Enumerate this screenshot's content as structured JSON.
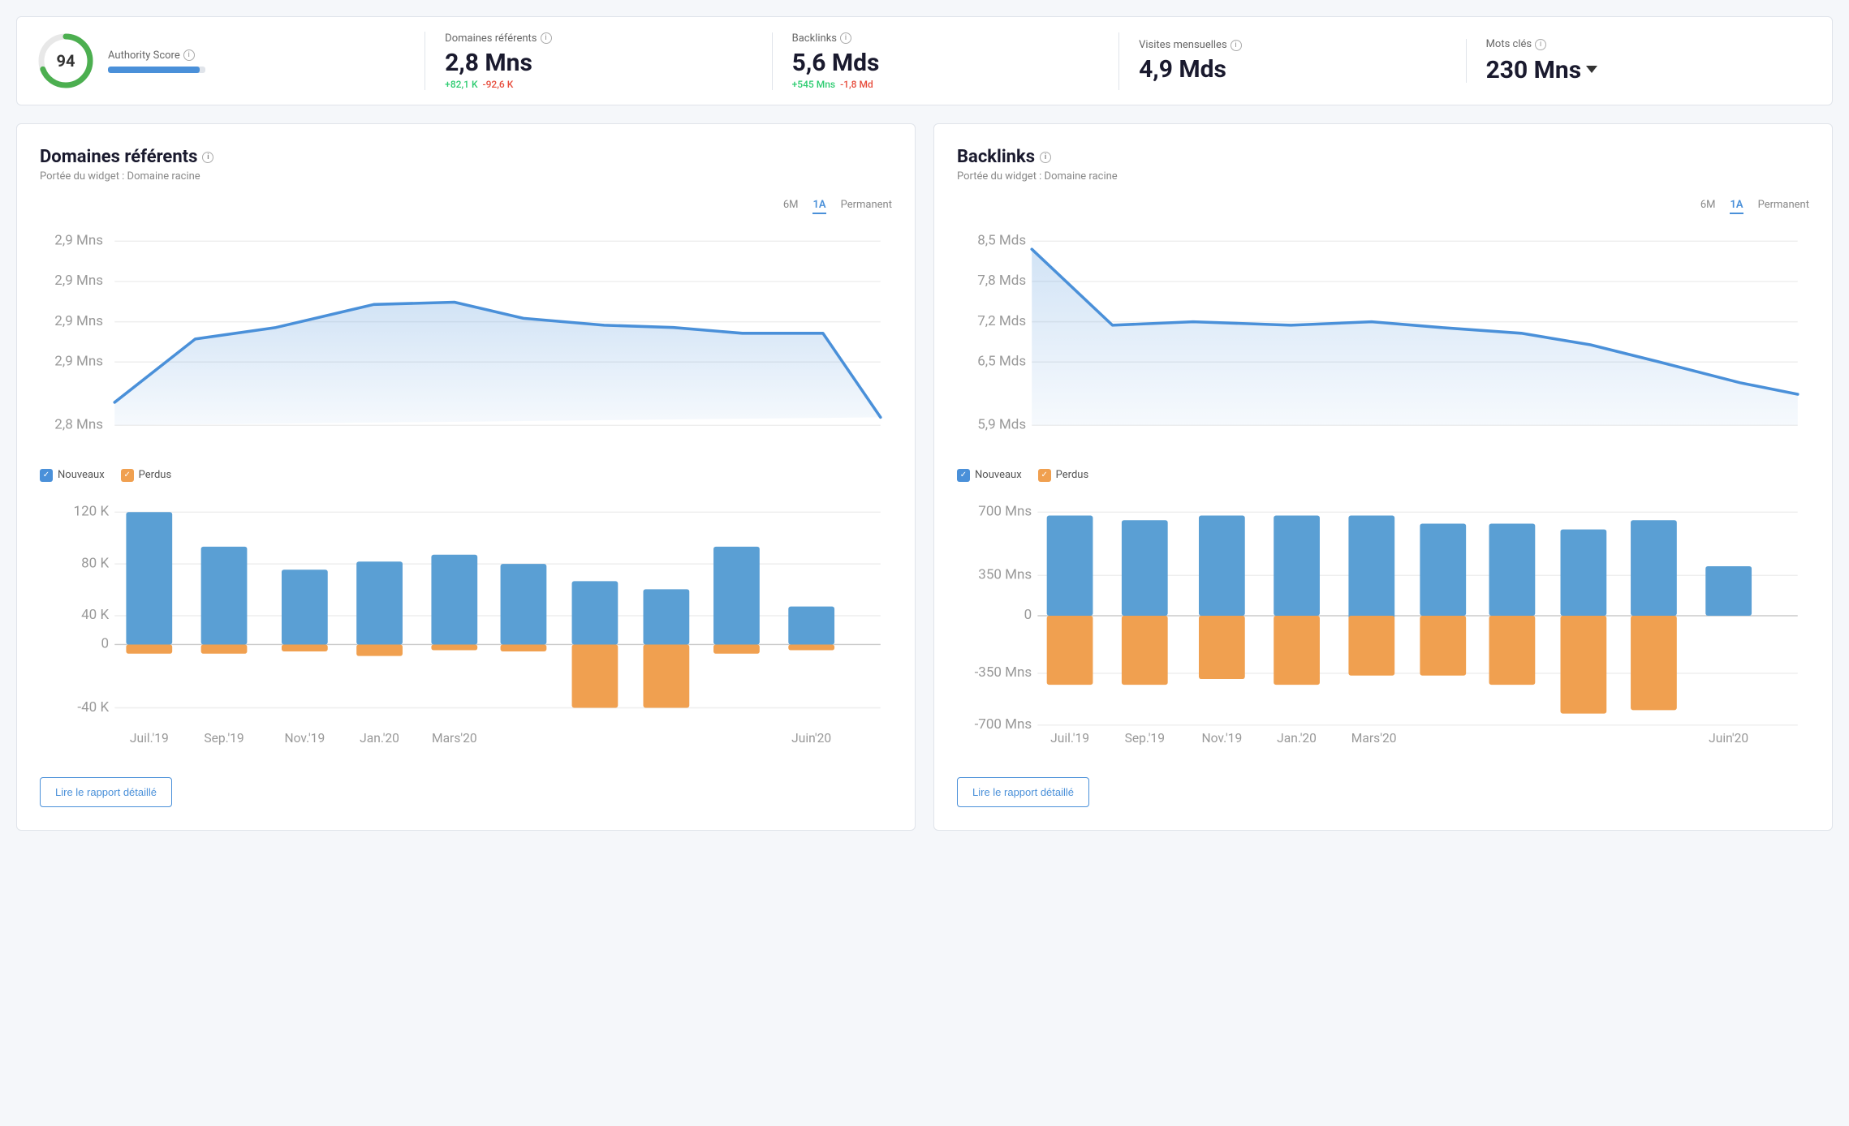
{
  "metrics": {
    "authority_score": {
      "label": "Authority Score",
      "value": "94",
      "progress_pct": 94
    },
    "domaines_referents": {
      "label": "Domaines référents",
      "value": "2,8 Mns",
      "change_pos": "+82,1 K",
      "change_neg": "-92,6 K"
    },
    "backlinks": {
      "label": "Backlinks",
      "value": "5,6 Mds",
      "change_pos": "+545 Mns",
      "change_neg": "-1,8 Md"
    },
    "visites_mensuelles": {
      "label": "Visites mensuelles",
      "value": "4,9 Mds"
    },
    "mots_cles": {
      "label": "Mots clés",
      "value": "230 Mns"
    }
  },
  "panel_left": {
    "title": "Domaines référents",
    "subtitle": "Portée du widget : Domaine racine",
    "tabs": [
      "6M",
      "1A",
      "Permanent"
    ],
    "active_tab": "1A",
    "y_labels_line": [
      "2,9 Mns",
      "2,9 Mns",
      "2,9 Mns",
      "2,9 Mns",
      "2,8 Mns"
    ],
    "x_labels": [
      "Juil.'19",
      "Sep.'19",
      "Nov.'19",
      "Jan.'20",
      "Mars'20",
      "Juin'20"
    ],
    "y_labels_bar": [
      "120 K",
      "80 K",
      "40 K",
      "0",
      "-40 K"
    ],
    "legend_new": "Nouveaux",
    "legend_lost": "Perdus",
    "report_btn": "Lire le rapport détaillé"
  },
  "panel_right": {
    "title": "Backlinks",
    "subtitle": "Portée du widget : Domaine racine",
    "tabs": [
      "6M",
      "1A",
      "Permanent"
    ],
    "active_tab": "1A",
    "y_labels_line": [
      "8,5 Mds",
      "7,8 Mds",
      "7,2 Mds",
      "6,5 Mds",
      "5,9 Mds"
    ],
    "x_labels": [
      "Juil.'19",
      "Sep.'19",
      "Nov.'19",
      "Jan.'20",
      "Mars'20",
      "Juin'20"
    ],
    "y_labels_bar": [
      "700 Mns",
      "350 Mns",
      "0",
      "-350 Mns",
      "-700 Mns"
    ],
    "legend_new": "Nouveaux",
    "legend_lost": "Perdus",
    "report_btn": "Lire le rapport détaillé"
  },
  "icons": {
    "info": "i",
    "check": "✓",
    "chevron_down": "▾"
  }
}
